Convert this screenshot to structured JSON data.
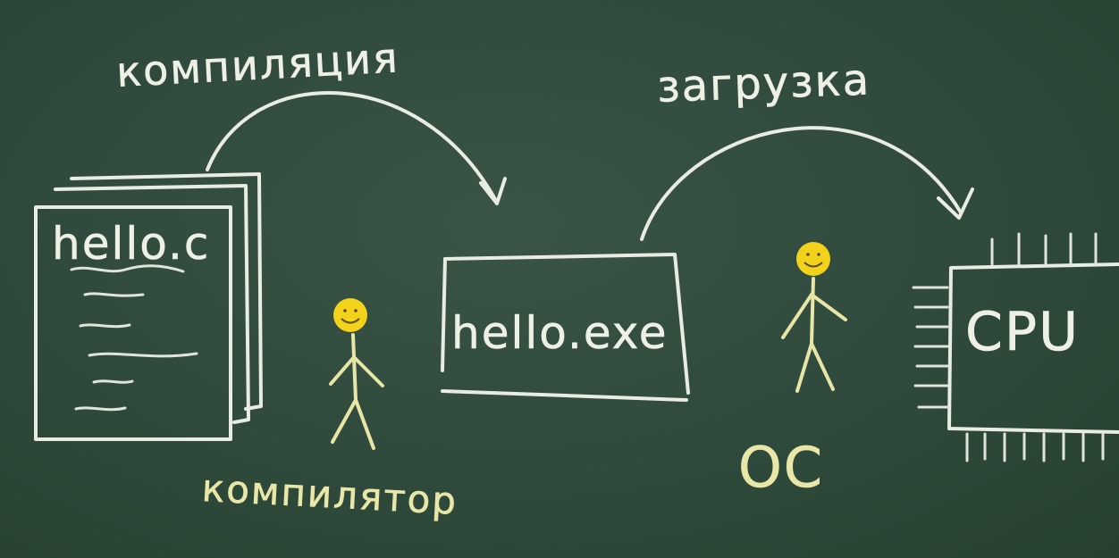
{
  "labels": {
    "compilation": "компиляция",
    "loading": "загрузка",
    "source_file": "hello.c",
    "executable": "hello.exe",
    "cpu": "CPU",
    "compiler": "компилятор",
    "os": "ОС"
  },
  "colors": {
    "board": "#2f4a3c",
    "chalk_white": "#eef0e6",
    "chalk_yellow": "#e9e7a8",
    "magnet": "#f2d21a"
  },
  "icons": {
    "compiler_figure": "stick-figure-icon",
    "os_figure": "stick-figure-icon",
    "magnet_face": "smiley-magnet-icon"
  }
}
